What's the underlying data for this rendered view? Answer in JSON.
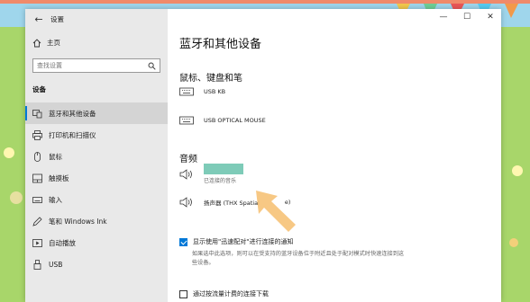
{
  "app": {
    "title": "设置",
    "back_icon": "back-arrow-icon"
  },
  "sidebar": {
    "home_label": "主页",
    "search_placeholder": "查找设置",
    "section_label": "设备",
    "items": [
      {
        "label": "蓝牙和其他设备",
        "icon": "bluetooth-devices-icon",
        "active": true
      },
      {
        "label": "打印机和扫描仪",
        "icon": "printer-icon",
        "active": false
      },
      {
        "label": "鼠标",
        "icon": "mouse-icon",
        "active": false
      },
      {
        "label": "触摸板",
        "icon": "touchpad-icon",
        "active": false
      },
      {
        "label": "输入",
        "icon": "keyboard-icon",
        "active": false
      },
      {
        "label": "笔和 Windows Ink",
        "icon": "pen-icon",
        "active": false
      },
      {
        "label": "自动播放",
        "icon": "autoplay-icon",
        "active": false
      },
      {
        "label": "USB",
        "icon": "usb-icon",
        "active": false
      }
    ]
  },
  "window_controls": {
    "minimize": "—",
    "maximize": "☐",
    "close": "✕"
  },
  "main": {
    "title": "蓝牙和其他设备",
    "input_section": {
      "heading": "鼠标、键盘和笔",
      "devices": [
        {
          "name": "USB KB",
          "icon": "keyboard-icon"
        },
        {
          "name": "USB OPTICAL MOUSE",
          "icon": "keyboard-icon"
        }
      ]
    },
    "audio_section": {
      "heading": "音频",
      "devices": [
        {
          "name": "",
          "status": "已连接的音乐",
          "icon": "speaker-icon",
          "redacted": true
        },
        {
          "name": "扬声器 (THX Spatial",
          "name_tail": "e)",
          "icon": "speaker-icon"
        }
      ]
    },
    "swift_pair": {
      "checked": true,
      "label": "显示使用\"迅速配对\"进行连接的通知",
      "description": "如果选中此选项，则可以在受支持的蓝牙设备位于附近且处于配对模式时快速连接到这些设备。"
    },
    "metered": {
      "checked": false,
      "label": "通过按流量计费的连接下载"
    }
  },
  "colors": {
    "accent": "#0078d7",
    "sidebar_bg": "#e9e9e9",
    "arrow": "#f6c37a",
    "redaction": "#7ecbb8"
  }
}
